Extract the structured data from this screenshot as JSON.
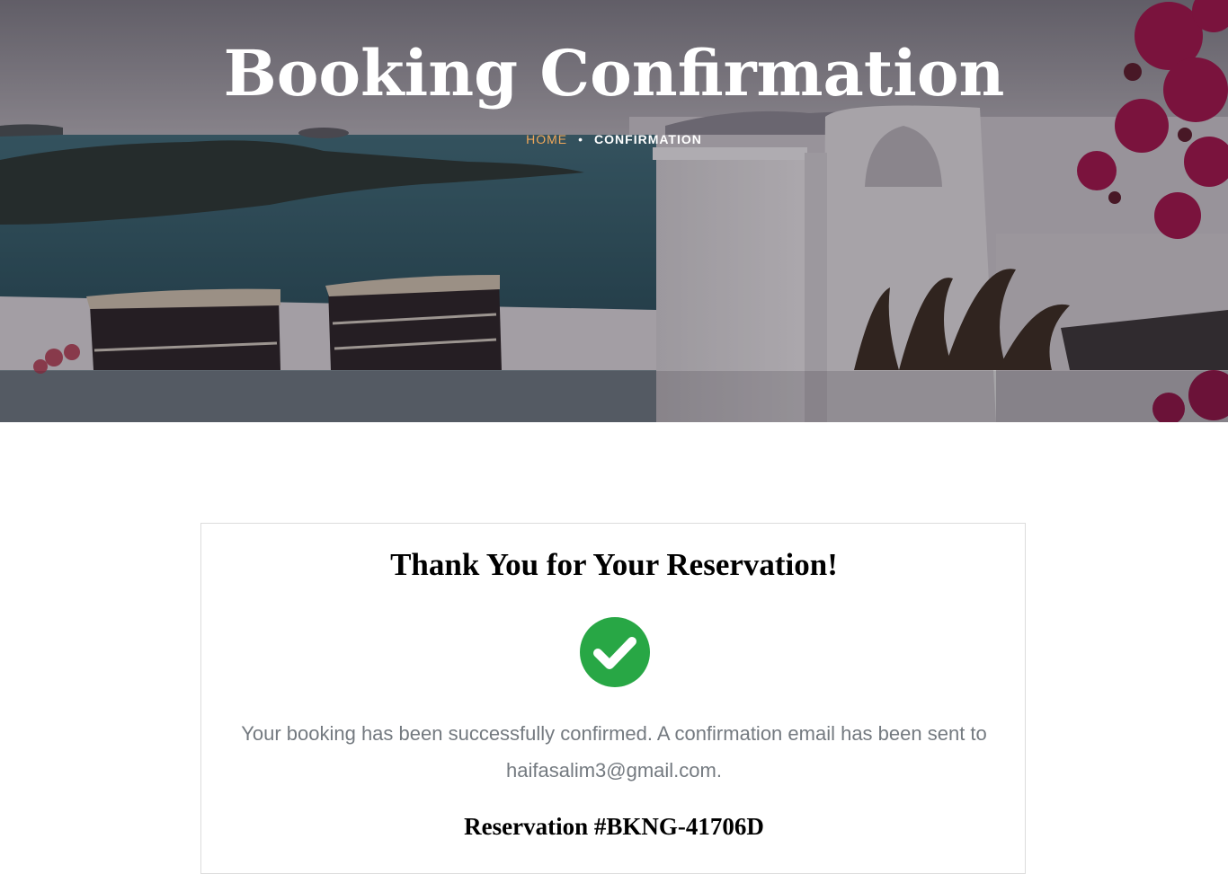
{
  "hero": {
    "title": "Booking Confirmation",
    "breadcrumb": {
      "home": "HOME",
      "separator": "•",
      "current": "CONFIRMATION"
    },
    "breadcrumb_home_color": "#f0a85a"
  },
  "confirmation": {
    "heading": "Thank You for Your Reservation!",
    "icon": "check-circle-icon",
    "icon_color": "#28a745",
    "message_prefix": "Your booking has been successfully confirmed. A confirmation email has been sent to",
    "email": "haifasalim3@gmail.com",
    "message_suffix": ".",
    "reservation_label": "Reservation #BKNG-41706D"
  }
}
